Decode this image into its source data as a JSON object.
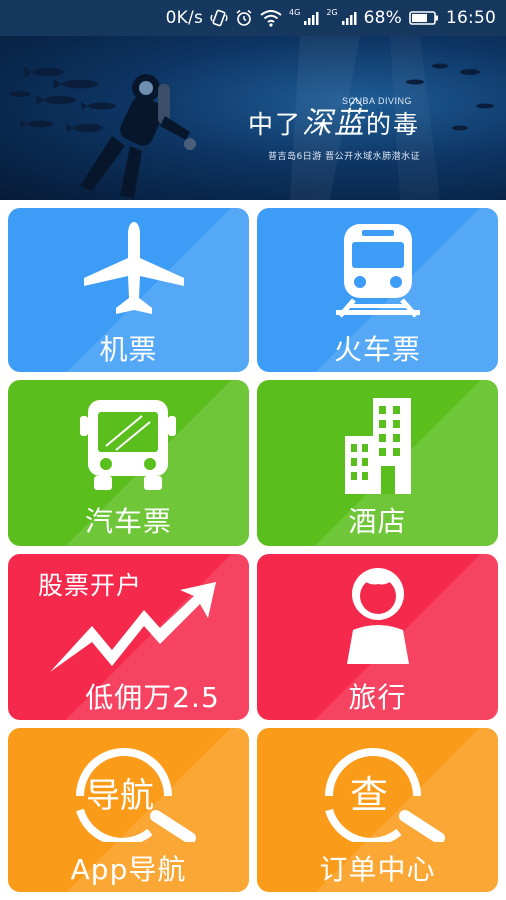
{
  "status_bar": {
    "speed": "0K/s",
    "network_a": "4G",
    "network_b": "2G",
    "battery": "68%",
    "time": "16:50"
  },
  "banner": {
    "title_prefix": "中了",
    "title_big": "深蓝",
    "title_suffix": "的毒",
    "subtitle_en": "SCUBA DIVING",
    "caption": "普吉岛6日游 晋公开水域水肺潜水证",
    "slide_count": 2,
    "active_slide": 2
  },
  "tiles": {
    "flight": {
      "label": "机票",
      "color": "#3d9cf5"
    },
    "train": {
      "label": "火车票",
      "color": "#3d9cf5"
    },
    "bus": {
      "label": "汽车票",
      "color": "#5abe1c"
    },
    "hotel": {
      "label": "酒店",
      "color": "#5abe1c"
    },
    "stock": {
      "top_label": "股票开户",
      "label": "低佣万2.5",
      "color": "#f5294c"
    },
    "travel": {
      "label": "旅行",
      "color": "#f5294c"
    },
    "app_nav": {
      "label": "App导航",
      "icon_text": "导航",
      "color": "#fa9b1a"
    },
    "orders": {
      "label": "订单中心",
      "icon_text": "查",
      "color": "#fa9b1a"
    }
  }
}
